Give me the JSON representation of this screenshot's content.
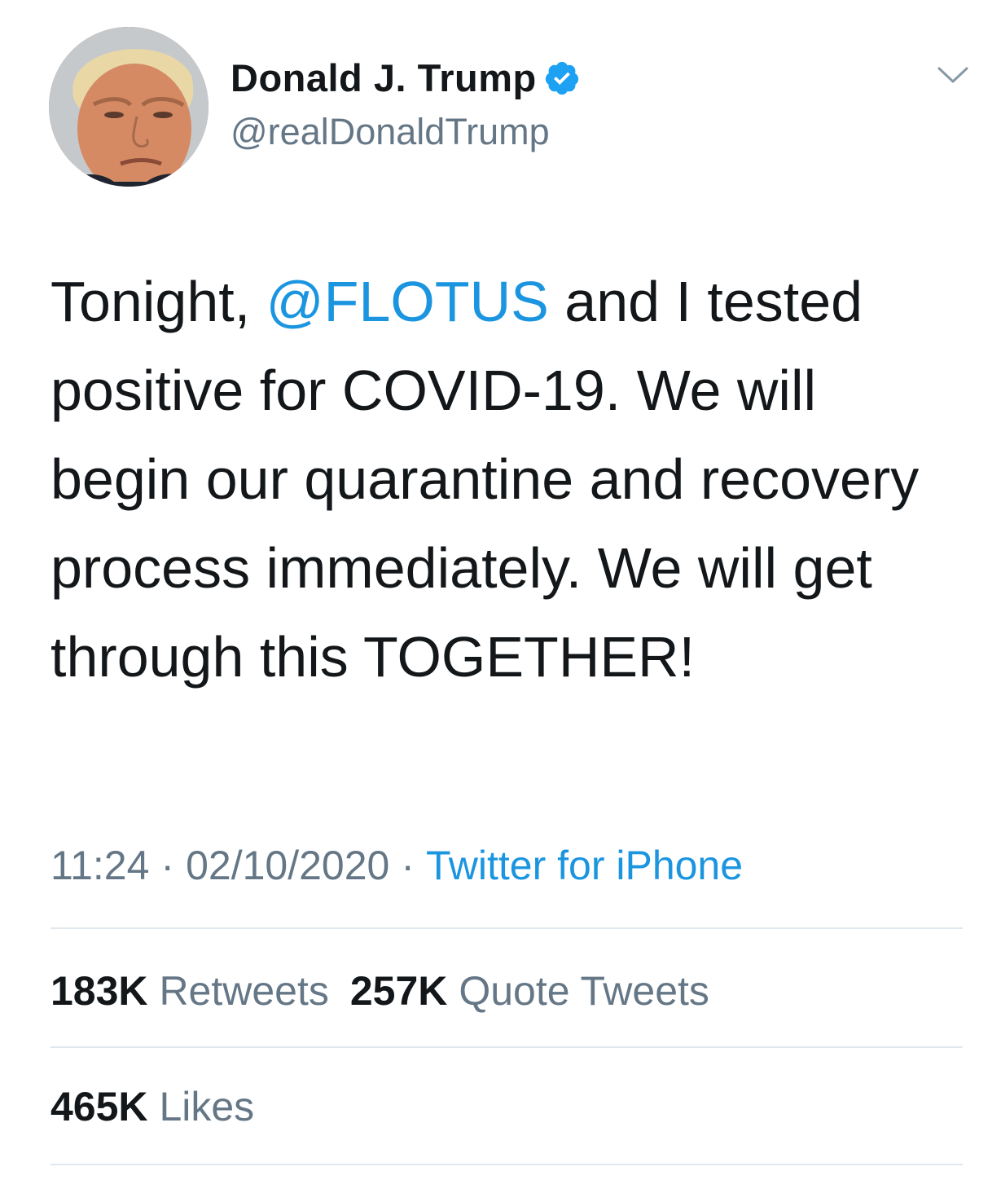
{
  "author": {
    "display_name": "Donald J. Trump",
    "handle": "@realDonaldTrump",
    "verified": true,
    "avatar_icon": "profile-photo"
  },
  "tweet": {
    "text_parts": [
      {
        "type": "text",
        "value": "Tonight, "
      },
      {
        "type": "mention",
        "value": "@FLOTUS"
      },
      {
        "type": "text",
        "value": " and I tested positive for COVID-19. We will begin our quarantine and recovery process immediately. We will get through this TOGETHER!"
      }
    ]
  },
  "meta": {
    "time": "11:24",
    "separator": "·",
    "date": "02/10/2020",
    "source": "Twitter for iPhone"
  },
  "stats": {
    "retweets_count": "183K",
    "retweets_label": "Retweets",
    "quotes_count": "257K",
    "quotes_label": "Quote Tweets",
    "likes_count": "465K",
    "likes_label": "Likes"
  },
  "colors": {
    "text": "#14171a",
    "secondary": "#657786",
    "link": "#1b95e0",
    "verified": "#1da1f2",
    "divider": "#e1e8ed"
  }
}
